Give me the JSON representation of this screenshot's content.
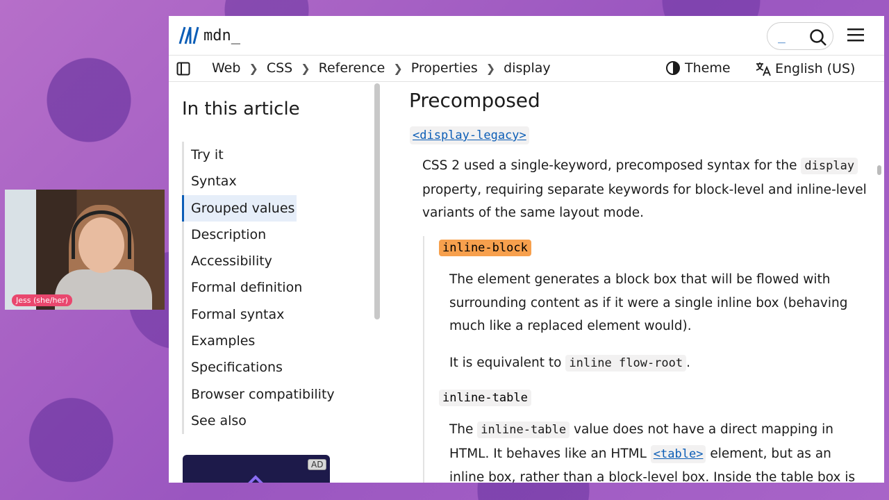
{
  "header": {
    "logo_text": "mdn_",
    "search_cursor": "_"
  },
  "breadcrumbs": [
    "Web",
    "CSS",
    "Reference",
    "Properties",
    "display"
  ],
  "theme_label": "Theme",
  "language_label": "English (US)",
  "toc": {
    "title": "In this article",
    "items": [
      "Try it",
      "Syntax",
      "Grouped values",
      "Description",
      "Accessibility",
      "Formal definition",
      "Formal syntax",
      "Examples",
      "Specifications",
      "Browser compatibility",
      "See also"
    ],
    "active_index": 2
  },
  "ad": {
    "badge": "AD"
  },
  "content": {
    "heading": "Precomposed",
    "term1": "<display-legacy>",
    "para1_a": "CSS 2 used a single-keyword, precomposed syntax for the ",
    "para1_code": "display",
    "para1_b": " property, requiring separate keywords for block-level and inline-level variants of the same layout mode.",
    "term2": "inline-block",
    "para2": "The element generates a block box that will be flowed with surrounding content as if it were a single inline box (behaving much like a replaced element would).",
    "para3_a": "It is equivalent to ",
    "para3_code": "inline flow-root",
    "para3_b": ".",
    "term3": "inline-table",
    "para4_a": "The ",
    "para4_code": "inline-table",
    "para4_b": " value does not have a direct mapping in HTML. It behaves like an HTML ",
    "para4_link": "<table>",
    "para4_c": " element, but as an inline box, rather than a block-level box. Inside the table box is a"
  },
  "webcam": {
    "name_label": "Jess (she/her)"
  },
  "colors": {
    "accent": "#0b5db6",
    "highlight": "#f7a04d",
    "label_pink": "#e9476e"
  }
}
